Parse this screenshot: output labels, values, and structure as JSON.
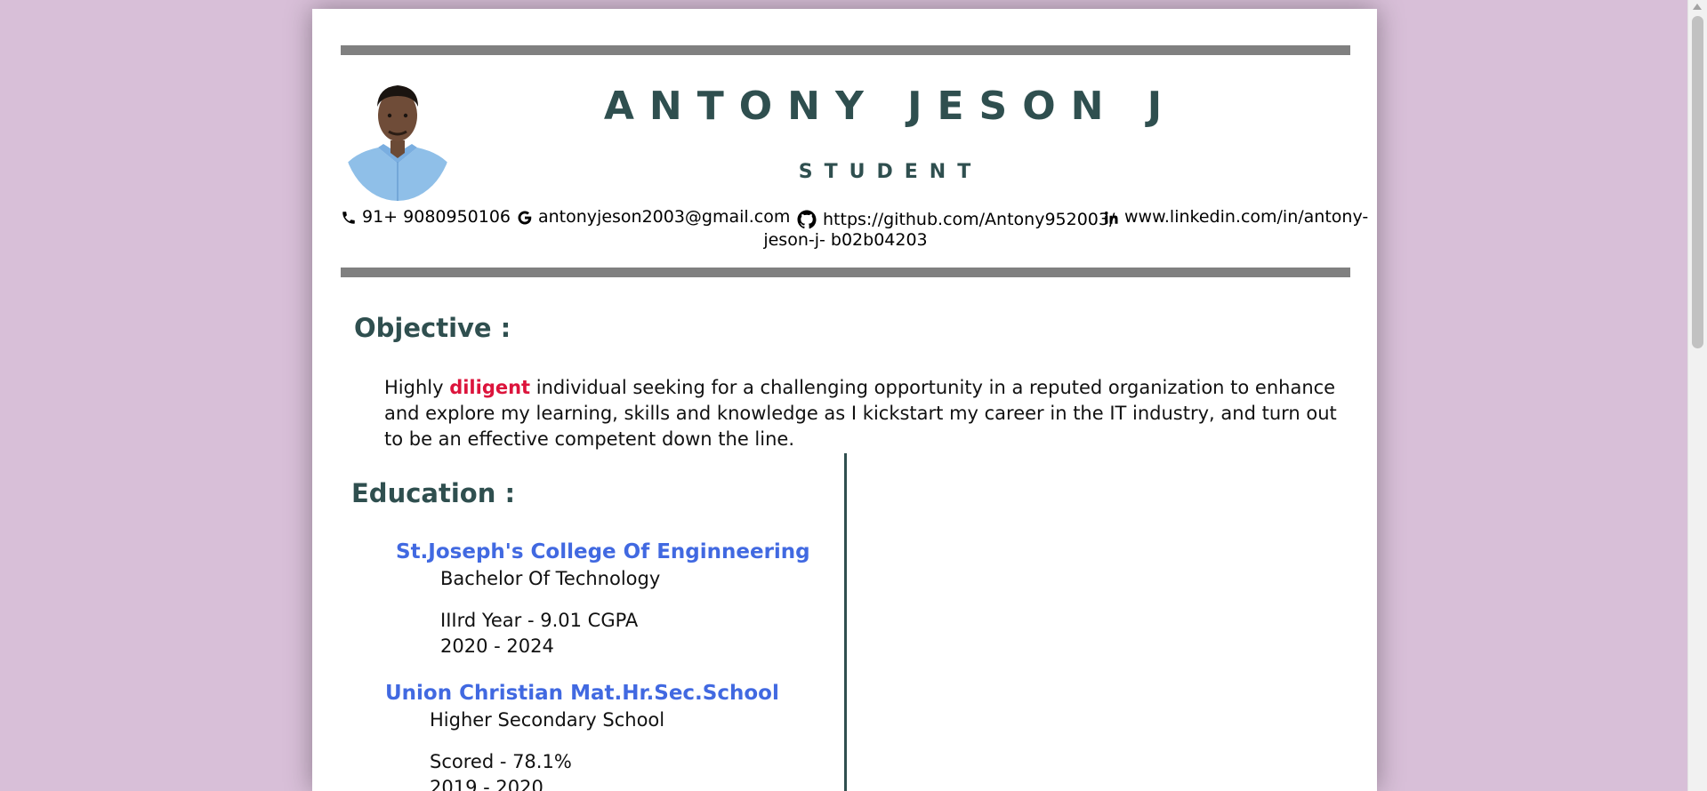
{
  "header": {
    "name": "ANTONY JESON J",
    "role": "STUDENT",
    "photo_alt": "profile photo"
  },
  "contact": {
    "phone": "91+ 9080950106",
    "email": "antonyjeson2003@gmail.com",
    "github": "https://github.com/Antony952003/",
    "linkedin_part1": "www.linkedin.com/in/antony-",
    "linkedin_part2": "jeson-j- b02b04203",
    "icons": [
      "phone-icon",
      "google-icon",
      "github-icon",
      "linkedin-icon"
    ]
  },
  "objective": {
    "heading": "Objective :",
    "text_before": "Highly ",
    "highlight": "diligent",
    "text_after": " individual seeking for a challenging opportunity in a reputed organization to enhance and explore my learning, skills and knowledge as I kickstart my career in the IT industry, and turn out to be an effective competent down the line."
  },
  "education": {
    "heading": "Education :",
    "entries": [
      {
        "school": "St.Joseph's College Of Enginneering",
        "degree": "Bachelor Of Technology",
        "score": "IIIrd Year - 9.01 CGPA",
        "years": "2020 - 2024"
      },
      {
        "school": "Union Christian Mat.Hr.Sec.School",
        "degree": "Higher Secondary School",
        "score": "Scored - 78.1%",
        "years": "2019 - 2020"
      }
    ]
  },
  "colors": {
    "background": "#d8bfd8",
    "heading": "#2f4f4f",
    "school": "#4169e1",
    "highlight": "#dc143c",
    "rule": "#808080"
  }
}
